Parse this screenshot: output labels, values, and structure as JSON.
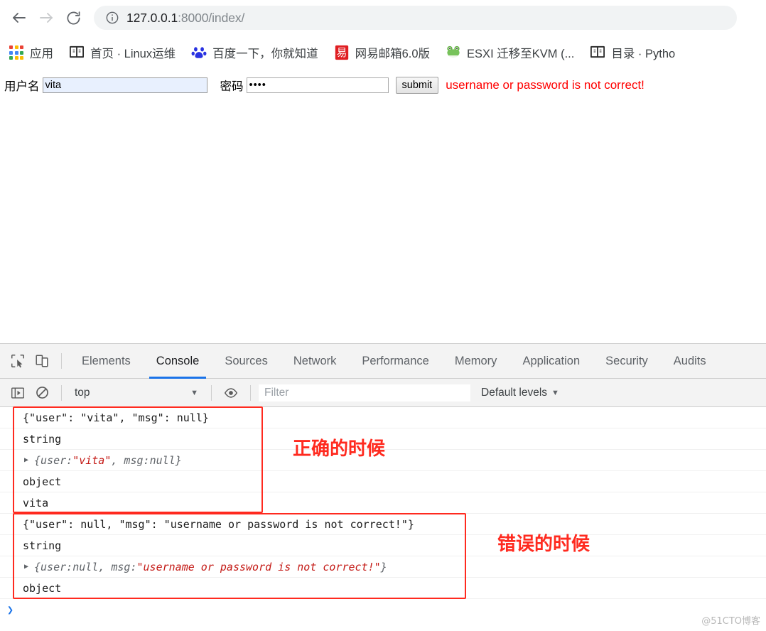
{
  "browser": {
    "back_icon": "back-arrow-icon",
    "forward_icon": "forward-arrow-icon",
    "reload_icon": "reload-icon",
    "site_info_icon": "info-circle-icon",
    "url_host": "127.0.0.1",
    "url_path": ":8000/index/",
    "url_full": "127.0.0.1:8000/index/"
  },
  "bookmarks": [
    {
      "label": "应用",
      "icon": "apps-grid-icon"
    },
    {
      "label": "首页 · Linux运维",
      "icon": "book-icon"
    },
    {
      "label": "百度一下，你就知道",
      "icon": "baidu-icon"
    },
    {
      "label": "网易邮箱6.0版",
      "icon": "netease-icon"
    },
    {
      "label": "ESXI 迁移至KVM (...",
      "icon": "frog-icon"
    },
    {
      "label": "目录 · Pytho",
      "icon": "book-icon"
    }
  ],
  "page": {
    "username_label": "用户名",
    "username_value": "vita",
    "password_label": "密码",
    "password_value": "••••",
    "submit_label": "submit",
    "error_message": "username or password is not correct!",
    "error_color": "#ff0000"
  },
  "devtools": {
    "inspect_icon": "inspect-element-icon",
    "device_icon": "device-toolbar-icon",
    "tabs": [
      {
        "label": "Elements",
        "active": false
      },
      {
        "label": "Console",
        "active": true
      },
      {
        "label": "Sources",
        "active": false
      },
      {
        "label": "Network",
        "active": false
      },
      {
        "label": "Performance",
        "active": false
      },
      {
        "label": "Memory",
        "active": false
      },
      {
        "label": "Application",
        "active": false
      },
      {
        "label": "Security",
        "active": false
      },
      {
        "label": "Audits",
        "active": false
      }
    ],
    "active_tab_color": "#1a73e8",
    "toolbar": {
      "sidebar_icon": "show-console-sidebar-icon",
      "clear_icon": "clear-console-icon",
      "context_value": "top",
      "context_caret": "▼",
      "eye_icon": "live-expression-eye-icon",
      "filter_placeholder": "Filter",
      "filter_value": "",
      "levels_label": "Default levels",
      "levels_caret": "▼"
    },
    "console_rows": [
      {
        "text": "{\"user\": \"vita\", \"msg\": null}",
        "type": "plain",
        "group": "correct"
      },
      {
        "text": "string",
        "type": "plain",
        "group": "correct"
      },
      {
        "text": "{user: \"vita\", msg: null}",
        "type": "object",
        "group": "correct",
        "parts": [
          {
            "t": "{user: ",
            "k": "plain"
          },
          {
            "t": "\"vita\"",
            "k": "string"
          },
          {
            "t": ", msg: ",
            "k": "plain"
          },
          {
            "t": "null",
            "k": "null"
          },
          {
            "t": "}",
            "k": "plain"
          }
        ]
      },
      {
        "text": "object",
        "type": "plain",
        "group": "correct"
      },
      {
        "text": "vita",
        "type": "plain",
        "group": "correct"
      },
      {
        "text": "{\"user\": null, \"msg\": \"username or password is not correct!\"}",
        "type": "plain",
        "group": "error"
      },
      {
        "text": "string",
        "type": "plain",
        "group": "error"
      },
      {
        "text": "{user: null, msg: \"username or password is not correct!\"}",
        "type": "object",
        "group": "error",
        "parts": [
          {
            "t": "{user: ",
            "k": "plain"
          },
          {
            "t": "null",
            "k": "null"
          },
          {
            "t": ", msg: ",
            "k": "plain"
          },
          {
            "t": "\"username or password is not correct!\"",
            "k": "string"
          },
          {
            "t": "}",
            "k": "plain"
          }
        ]
      },
      {
        "text": "object",
        "type": "plain",
        "group": "error"
      }
    ],
    "prompt_symbol": "❯",
    "expand_triangle": "▶"
  },
  "annotations": {
    "correct_label": "正确的时候",
    "error_label": "错误的时候",
    "color": "#ff2a1f"
  },
  "watermark": "@51CTO博客"
}
